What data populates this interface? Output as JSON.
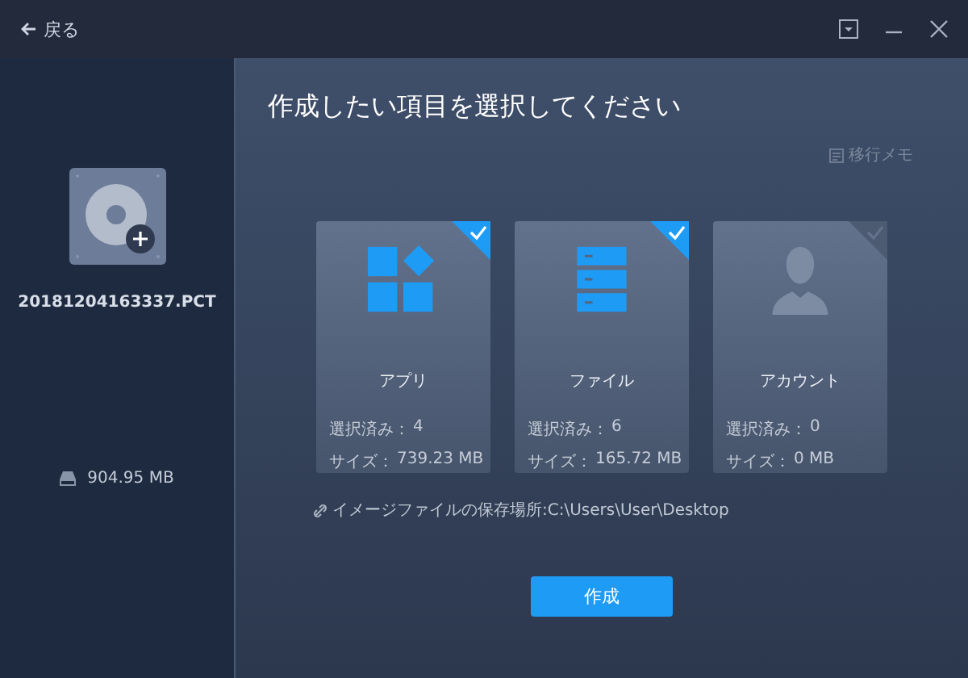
{
  "top_bar": {
    "back": "戻る"
  },
  "sidebar": {
    "file_name": "20181204163337.PCT",
    "disk_size": "904.95 MB"
  },
  "main": {
    "title": "作成したい項目を選択してください",
    "memo": "移行メモ",
    "cards": [
      {
        "kind": "app",
        "label": "アプリ",
        "selected": true,
        "count_label": "選択済み：",
        "count": "4",
        "size_label": "サイズ：",
        "size": "739.23 MB"
      },
      {
        "kind": "file",
        "label": "ファイル",
        "selected": true,
        "count_label": "選択済み：",
        "count": "6",
        "size_label": "サイズ：",
        "size": "165.72 MB"
      },
      {
        "kind": "account",
        "label": "アカウント",
        "selected": false,
        "count_label": "選択済み：",
        "count": "0",
        "size_label": "サイズ：",
        "size": "0 MB"
      }
    ],
    "save_location": "イメージファイルの保存場所:C:\\Users\\User\\Desktop",
    "create_button": "作成"
  }
}
